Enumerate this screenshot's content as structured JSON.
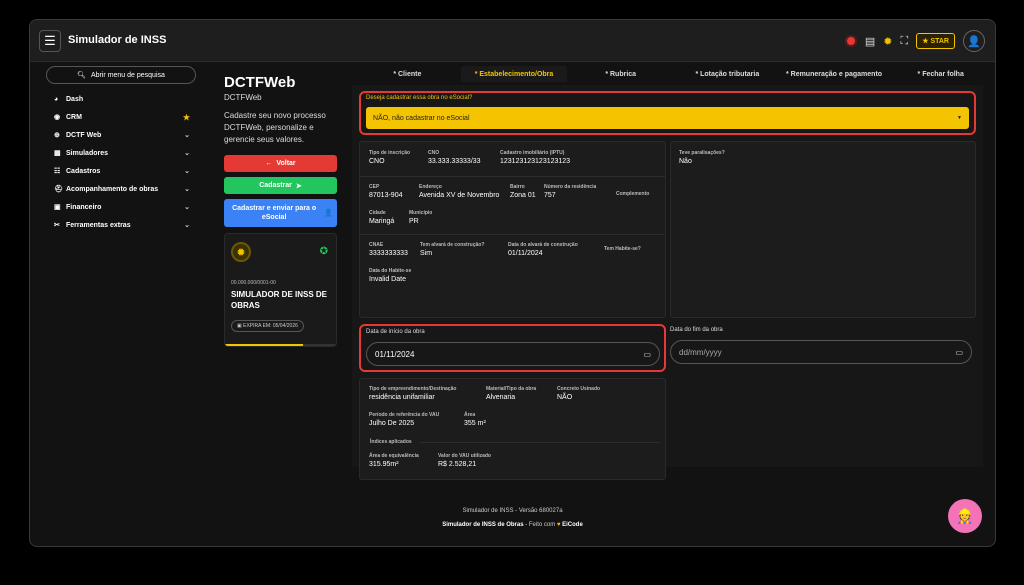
{
  "app": {
    "title": "Simulador de INSS"
  },
  "topbar": {
    "star_label": "STAR"
  },
  "sidebar": {
    "search_label": "Abrir menu de pesquisa",
    "items": [
      {
        "label": "Dash",
        "icon": "gauge-icon"
      },
      {
        "label": "CRM",
        "icon": "crm-icon",
        "favorite": true
      },
      {
        "label": "DCTF Web",
        "icon": "globe-icon",
        "expandable": true
      },
      {
        "label": "Simuladores",
        "icon": "calculator-icon",
        "expandable": true
      },
      {
        "label": "Cadastros",
        "icon": "list-icon",
        "expandable": true
      },
      {
        "label": "Acompanhamento de obras",
        "icon": "helmet-icon",
        "expandable": true
      },
      {
        "label": "Financeiro",
        "icon": "money-icon",
        "expandable": true
      },
      {
        "label": "Ferramentas extras",
        "icon": "tools-icon",
        "expandable": true
      }
    ]
  },
  "panel": {
    "title": "DCTFWeb",
    "subtitle": "DCTFWeb",
    "description": "Cadastre seu novo processo DCTFWeb, personalize e gerencie seus valores.",
    "back_label": "Voltar",
    "register_label": "Cadastrar",
    "register_send_label": "Cadastrar e enviar para o eSocial"
  },
  "certificate": {
    "cnpj": "00.000.000/0001-00",
    "name": "SIMULADOR DE INSS DE OBRAS",
    "expiry": "EXPIRA EM: 05/04/2026",
    "validity_progress": 0.7
  },
  "tabs": [
    {
      "label": "* Cliente",
      "active": false
    },
    {
      "label": "* Estabelecimento/Obra",
      "active": true
    },
    {
      "label": "* Rubrica",
      "active": false
    },
    {
      "label": "* Lotação tributaria",
      "active": false
    },
    {
      "label": "* Remuneração e pagamento",
      "active": false
    },
    {
      "label": "* Fechar folha",
      "active": false
    }
  ],
  "esocial": {
    "question": "Deseja cadastrar essa obra no eSocial?",
    "selected": "NÃO, não cadastrar no eSocial"
  },
  "obra": {
    "tipo_inscricao": {
      "label": "Tipo de inscrição",
      "value": "CNO"
    },
    "cno": {
      "label": "CNO",
      "value": "33.333.33333/33"
    },
    "iptu": {
      "label": "Cadastro imobiliário (IPTU)",
      "value": "123123123123123123"
    },
    "cep": {
      "label": "CEP",
      "value": "87013-904"
    },
    "endereco": {
      "label": "Endereço",
      "value": "Avenida XV de Novembro"
    },
    "bairro": {
      "label": "Bairro",
      "value": "Zona 01"
    },
    "numero": {
      "label": "Número da residência",
      "value": "757"
    },
    "complemento": {
      "label": "Complemento",
      "value": ""
    },
    "cidade": {
      "label": "Cidade",
      "value": "Maringá"
    },
    "municipio": {
      "label": "Município",
      "value": "PR"
    },
    "cnae": {
      "label": "CNAE",
      "value": "3333333333"
    },
    "alvara": {
      "label": "Tem alvará de construção?",
      "value": "Sim"
    },
    "data_alvara": {
      "label": "Data do alvará de construção",
      "value": "01/11/2024"
    },
    "habite_se": {
      "label": "Tem Habite-se?",
      "value": ""
    },
    "data_habite_se": {
      "label": "Data do Habite-se",
      "value": "Invalid Date"
    },
    "paralisacoes": {
      "label": "Teve paralisações?",
      "value": "Não"
    }
  },
  "dates": {
    "inicio_label": "Data de início da obra",
    "inicio_value": "01/11/2024",
    "fim_label": "Data do fim da obra",
    "fim_placeholder": "dd/mm/yyyy"
  },
  "empreendimento": {
    "tipo": {
      "label": "Tipo de empreendimento/Destinação",
      "value": "residência unifamiliar"
    },
    "material": {
      "label": "Material/Tipo da obra",
      "value": "Alvenaria"
    },
    "concreto": {
      "label": "Concreto Usinado",
      "value": "NÃO"
    },
    "periodo": {
      "label": "Período de referência do VAU",
      "value": "Julho De 2025"
    },
    "area": {
      "label": "Área",
      "value": "355 m²"
    },
    "indices_label": "Índices aplicados",
    "area_equiv": {
      "label": "Área de equivalência",
      "value": "315.95m²"
    },
    "vau": {
      "label": "Valor do VAU utilizado",
      "value": "R$ 2.528,21"
    }
  },
  "footer": {
    "version": "Simulador de INSS - Versão 680027a",
    "brand": "Simulador de INSS de Obras",
    "made_with": "Feito com",
    "author": "EiCode"
  }
}
